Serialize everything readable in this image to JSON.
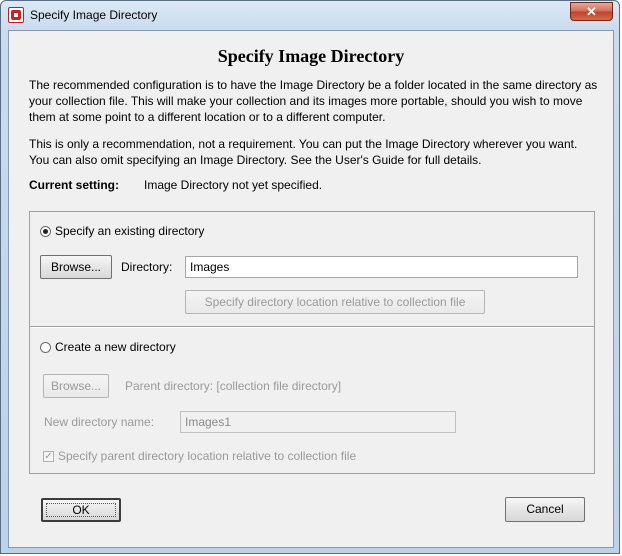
{
  "window": {
    "title": "Specify Image Directory",
    "close_glyph": "✕"
  },
  "dialog": {
    "heading": "Specify Image Directory",
    "para1": "The recommended configuration is to have the Image Directory be a folder located in the same directory as your collection file.  This will make your collection and its images more portable, should you wish to move them at some point to a different location or to a different computer.",
    "para2": "This is only a recommendation, not a requirement. You can put the Image Directory wherever you want. You can also omit specifying an Image Directory. See the User's Guide for full details.",
    "current_label": "Current setting:",
    "current_value": "Image Directory not yet specified."
  },
  "existing": {
    "radio_label": "Specify an existing directory",
    "selected": true,
    "browse_label": "Browse...",
    "directory_label": "Directory:",
    "directory_value": "Images",
    "relative_button": "Specify directory location relative to collection file"
  },
  "create": {
    "radio_label": "Create a new directory",
    "selected": false,
    "browse_label": "Browse...",
    "parent_label": "Parent directory:",
    "parent_value": "[collection file directory]",
    "new_name_label": "New directory name:",
    "new_name_value": "Images1",
    "checkbox_label": "Specify parent directory location relative to collection file",
    "checkbox_checked": true
  },
  "buttons": {
    "ok": "OK",
    "cancel": "Cancel"
  }
}
